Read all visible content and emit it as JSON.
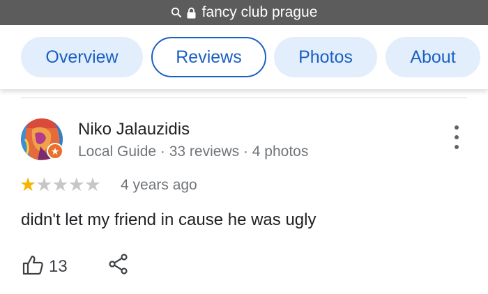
{
  "browser": {
    "url_text": "fancy club prague"
  },
  "tabs": [
    {
      "label": "Overview",
      "active": false
    },
    {
      "label": "Reviews",
      "active": true
    },
    {
      "label": "Photos",
      "active": false
    },
    {
      "label": "About",
      "active": false
    }
  ],
  "review": {
    "author": "Niko Jalauzidis",
    "author_meta": "Local Guide · 33 reviews · 4 photos",
    "rating": 1,
    "rating_max": 5,
    "time_ago": "4 years ago",
    "text": "didn't let my friend in cause he was ugly",
    "likes": "13"
  },
  "colors": {
    "accent": "#1a5fc2",
    "tab_bg": "#e3eefc",
    "star_filled": "#f4b400",
    "star_empty": "#c6c6c6",
    "guide_badge": "#e8702a"
  }
}
